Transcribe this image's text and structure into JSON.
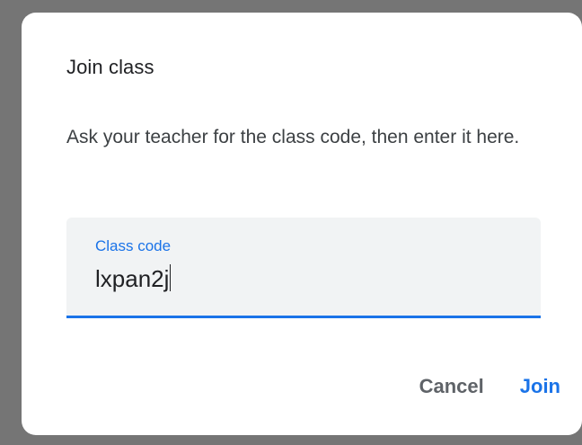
{
  "dialog": {
    "title": "Join class",
    "description": "Ask your teacher for the class code, then enter it here.",
    "field": {
      "label": "Class code",
      "value": "lxpan2j"
    },
    "actions": {
      "cancel_label": "Cancel",
      "join_label": "Join"
    }
  },
  "colors": {
    "accent": "#1a73e8",
    "backdrop": "#757575"
  }
}
